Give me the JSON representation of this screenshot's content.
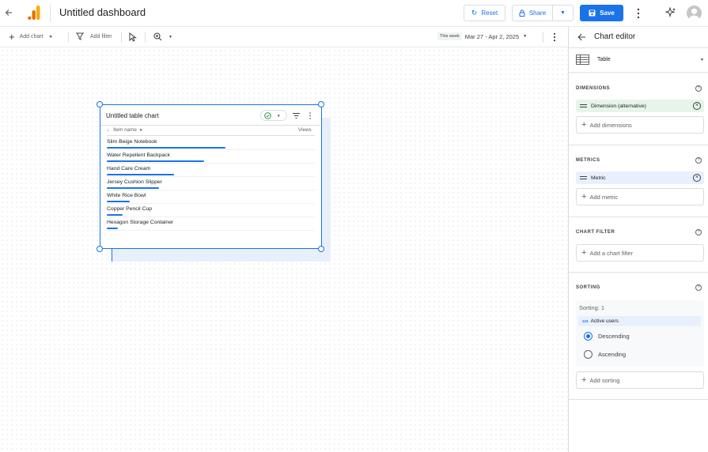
{
  "header": {
    "title": "Untitled dashboard",
    "reset_label": "Reset",
    "share_label": "Share",
    "save_label": "Save",
    "accent": "#1a73e8",
    "logo_colors": [
      "#f9ab00",
      "#e37400"
    ]
  },
  "toolbar": {
    "add_chart": "Add chart",
    "add_filter": "Add filter",
    "date_badge": "This week",
    "date_range": "Mar 27 - Apr 2, 2025"
  },
  "chart": {
    "title": "Untitled table chart",
    "column_dimension": "Item name",
    "column_metric": "Views",
    "rows": [
      {
        "name": "Slim Beige Notebook",
        "bar": 1.0
      },
      {
        "name": "Water Repellent Backpack",
        "bar": 0.82
      },
      {
        "name": "Hand Care Cream",
        "bar": 0.57
      },
      {
        "name": "Jersey Cushion Slipper",
        "bar": 0.44
      },
      {
        "name": "White Rice Bowl",
        "bar": 0.19
      },
      {
        "name": "Copper Pencil Cup",
        "bar": 0.13
      },
      {
        "name": "Hexagon Storage Container",
        "bar": 0.09
      }
    ]
  },
  "editor": {
    "title": "Chart editor",
    "chart_type": "Table",
    "dimensions_title": "DIMENSIONS",
    "dimension_chip": "Dimension (alternative)",
    "add_dimensions": "Add dimensions",
    "metrics_title": "METRICS",
    "metric_chip": "Metric",
    "add_metric": "Add metric",
    "filter_title": "CHART FILTER",
    "add_filter": "Add a chart filter",
    "sorting_title": "SORTING",
    "sorting_label": "Sorting: 1",
    "sort_field_badge": "123",
    "sort_field": "Active users",
    "descending": "Descending",
    "ascending": "Ascending",
    "add_sorting": "Add sorting",
    "chip_dim_color": "#e6f4ea",
    "chip_metric_color": "#e8f0fe"
  }
}
